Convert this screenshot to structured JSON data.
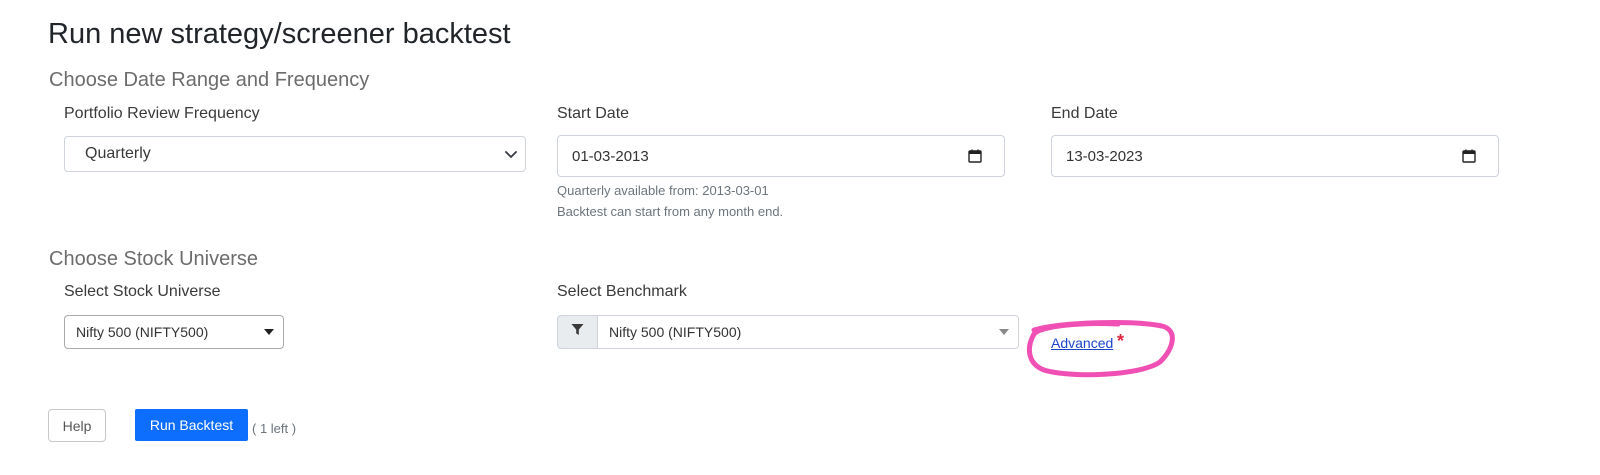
{
  "page": {
    "title": "Run new strategy/screener backtest"
  },
  "date_section": {
    "title": "Choose Date Range and Frequency",
    "frequency": {
      "label": "Portfolio Review Frequency",
      "value": "Quarterly"
    },
    "start_date": {
      "label": "Start Date",
      "value": "01-03-2013",
      "help_line1": "Quarterly available from: 2013-03-01",
      "help_line2": "Backtest can start from any month end."
    },
    "end_date": {
      "label": "End Date",
      "value": "13-03-2023"
    }
  },
  "universe_section": {
    "title": "Choose Stock Universe",
    "universe": {
      "label": "Select Stock Universe",
      "value": "Nifty 500 (NIFTY500)"
    },
    "benchmark": {
      "label": "Select Benchmark",
      "value": "Nifty 500 (NIFTY500)"
    },
    "advanced": {
      "label": "Advanced",
      "required_mark": "*"
    }
  },
  "actions": {
    "help_label": "Help",
    "run_label": "Run Backtest",
    "runs_left": "( 1 left )"
  },
  "icons": {
    "frequency_dropdown": "chevron-down-icon",
    "start_date_picker": "calendar-icon",
    "end_date_picker": "calendar-icon",
    "universe_dropdown": "caret-down-icon",
    "benchmark_filter": "filter-icon",
    "benchmark_dropdown": "caret-down-icon"
  },
  "colors": {
    "primary_button": "#0d6efd",
    "link": "#1a47c9",
    "required_star": "#e0243b",
    "annotation_circle": "#f04fb4"
  }
}
